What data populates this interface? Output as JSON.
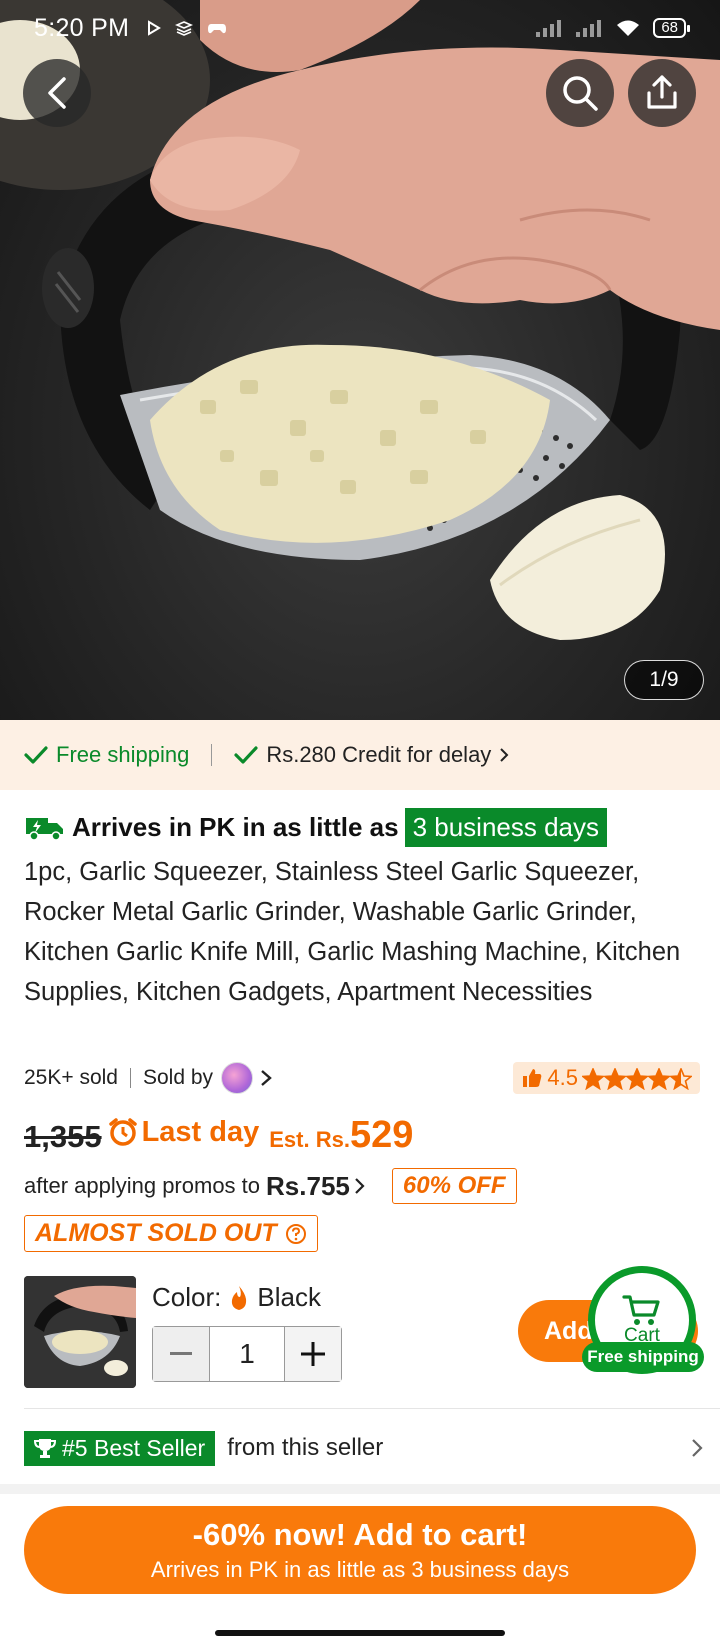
{
  "status_bar": {
    "time": "5:20 PM",
    "battery": "68",
    "icons": [
      "play-icon",
      "layers-icon",
      "gamepad-icon",
      "signal-icon",
      "signal-icon",
      "wifi-icon",
      "battery-icon"
    ]
  },
  "gallery": {
    "counter": "1/9"
  },
  "shipping": {
    "free_label": "Free shipping",
    "credit_label": "Rs.280 Credit for delay"
  },
  "product": {
    "arrives_prefix": "Arrives in PK in as little as",
    "arrives_badge": "3 business days",
    "title": "1pc, Garlic Squeezer, Stainless Steel Garlic Squeezer, Rocker Metal Garlic Grinder, Washable Garlic Grinder, Kitchen Garlic Knife Mill, Garlic Mashing Machine, Kitchen Supplies, Kitchen Gadgets, Apartment Necessities",
    "sold": "25K+ sold",
    "sold_by": "Sold by",
    "rating": "4.5",
    "rating_value": 4.5,
    "original_price": "1,355",
    "last_day": "Last day",
    "est_label": "Est. Rs.",
    "est_price": "529",
    "promo_text": "after applying promos to",
    "promo_price": "Rs.755",
    "off_tag": "60% OFF",
    "sold_out_tag": "ALMOST SOLD OUT",
    "color_label": "Color:",
    "color_value": "Black",
    "quantity": "1"
  },
  "actions": {
    "add_label": "Add",
    "cart_label": "Cart",
    "free_shipping_pill": "Free shipping"
  },
  "best_seller": {
    "tag": "#5 Best Seller",
    "text": "from this seller"
  },
  "cta": {
    "main": "-60% now! Add to cart!",
    "sub": "Arrives in PK in as little as 3 business days"
  },
  "colors": {
    "accent_orange": "#f97a0b",
    "price_orange": "#f26a00",
    "green": "#0a8a2a",
    "ship_strip_bg": "#fdf0e4"
  }
}
